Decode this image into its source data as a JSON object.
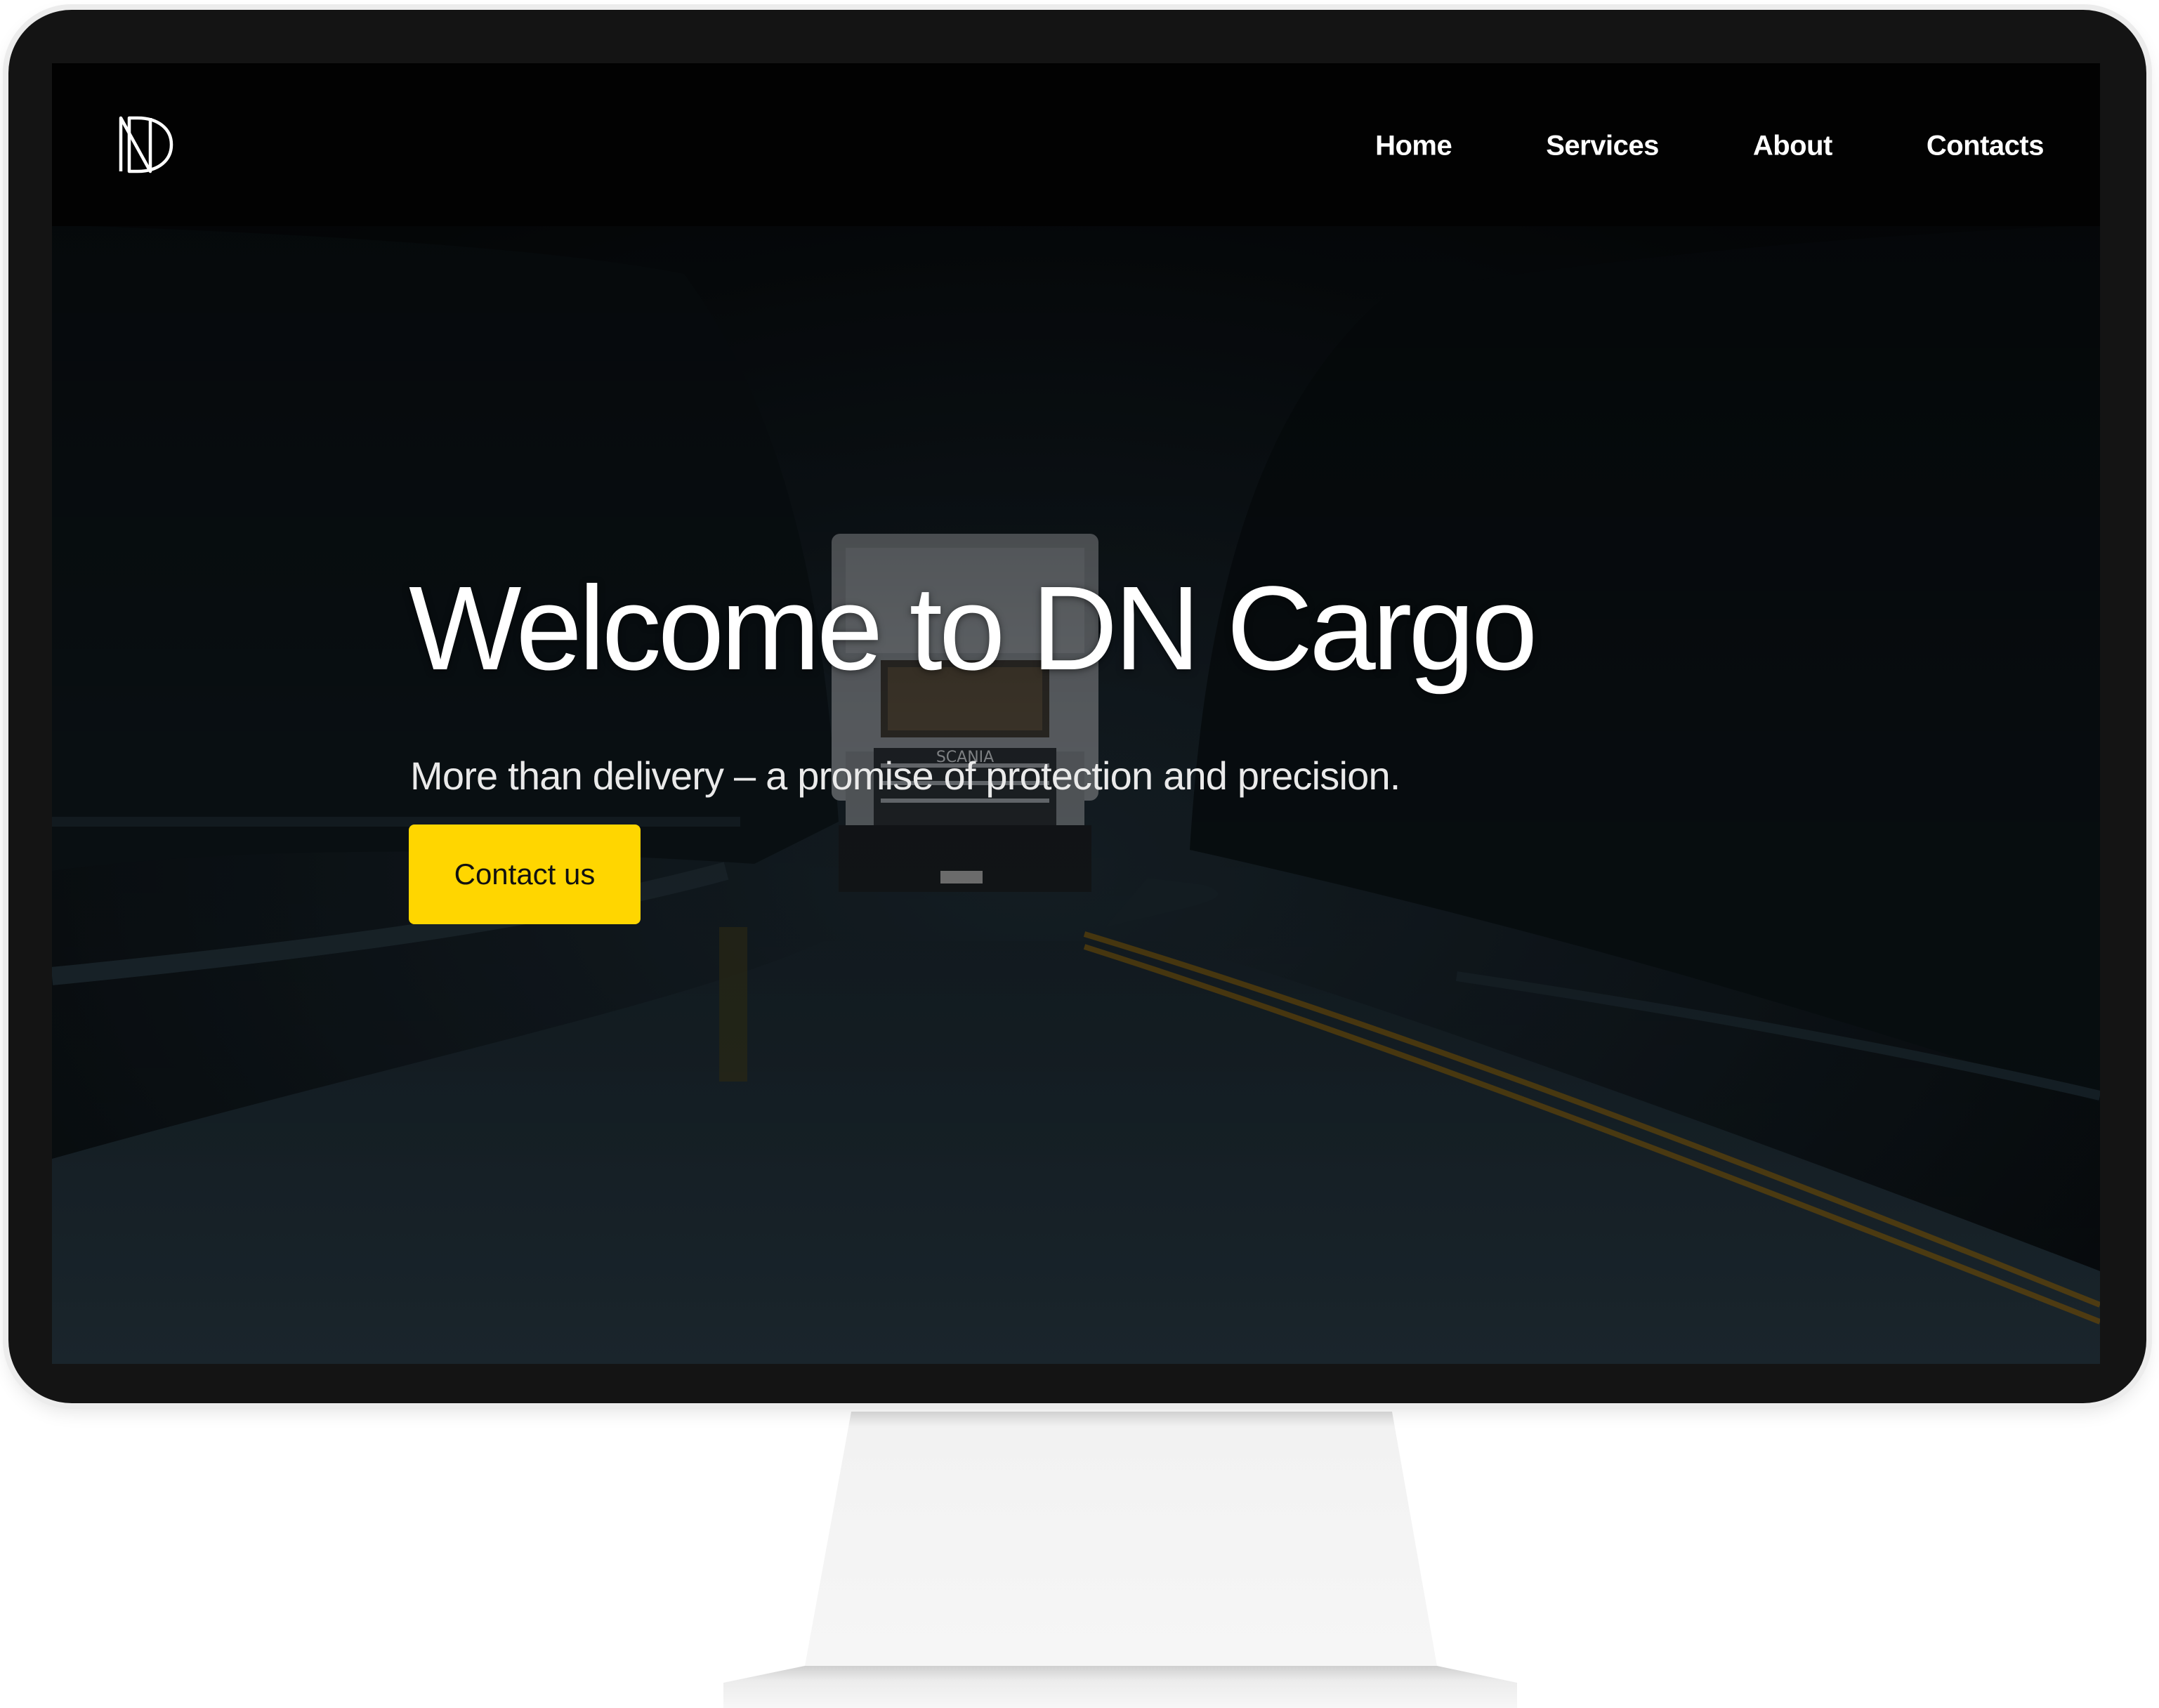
{
  "brand": {
    "logo_icon": "dn-monogram-icon"
  },
  "nav": {
    "items": [
      {
        "label": "Home"
      },
      {
        "label": "Services"
      },
      {
        "label": "About"
      },
      {
        "label": "Contacts"
      }
    ]
  },
  "hero": {
    "title": "Welcome to DN Cargo",
    "subtitle": "More than delivery – a promise of protection and precision.",
    "cta_label": "Contact us",
    "truck_brand_text": "SCANIA"
  },
  "colors": {
    "accent": "#ffd600",
    "navbar_bg": "#020202",
    "bezel": "#141414",
    "text": "#ffffff"
  }
}
